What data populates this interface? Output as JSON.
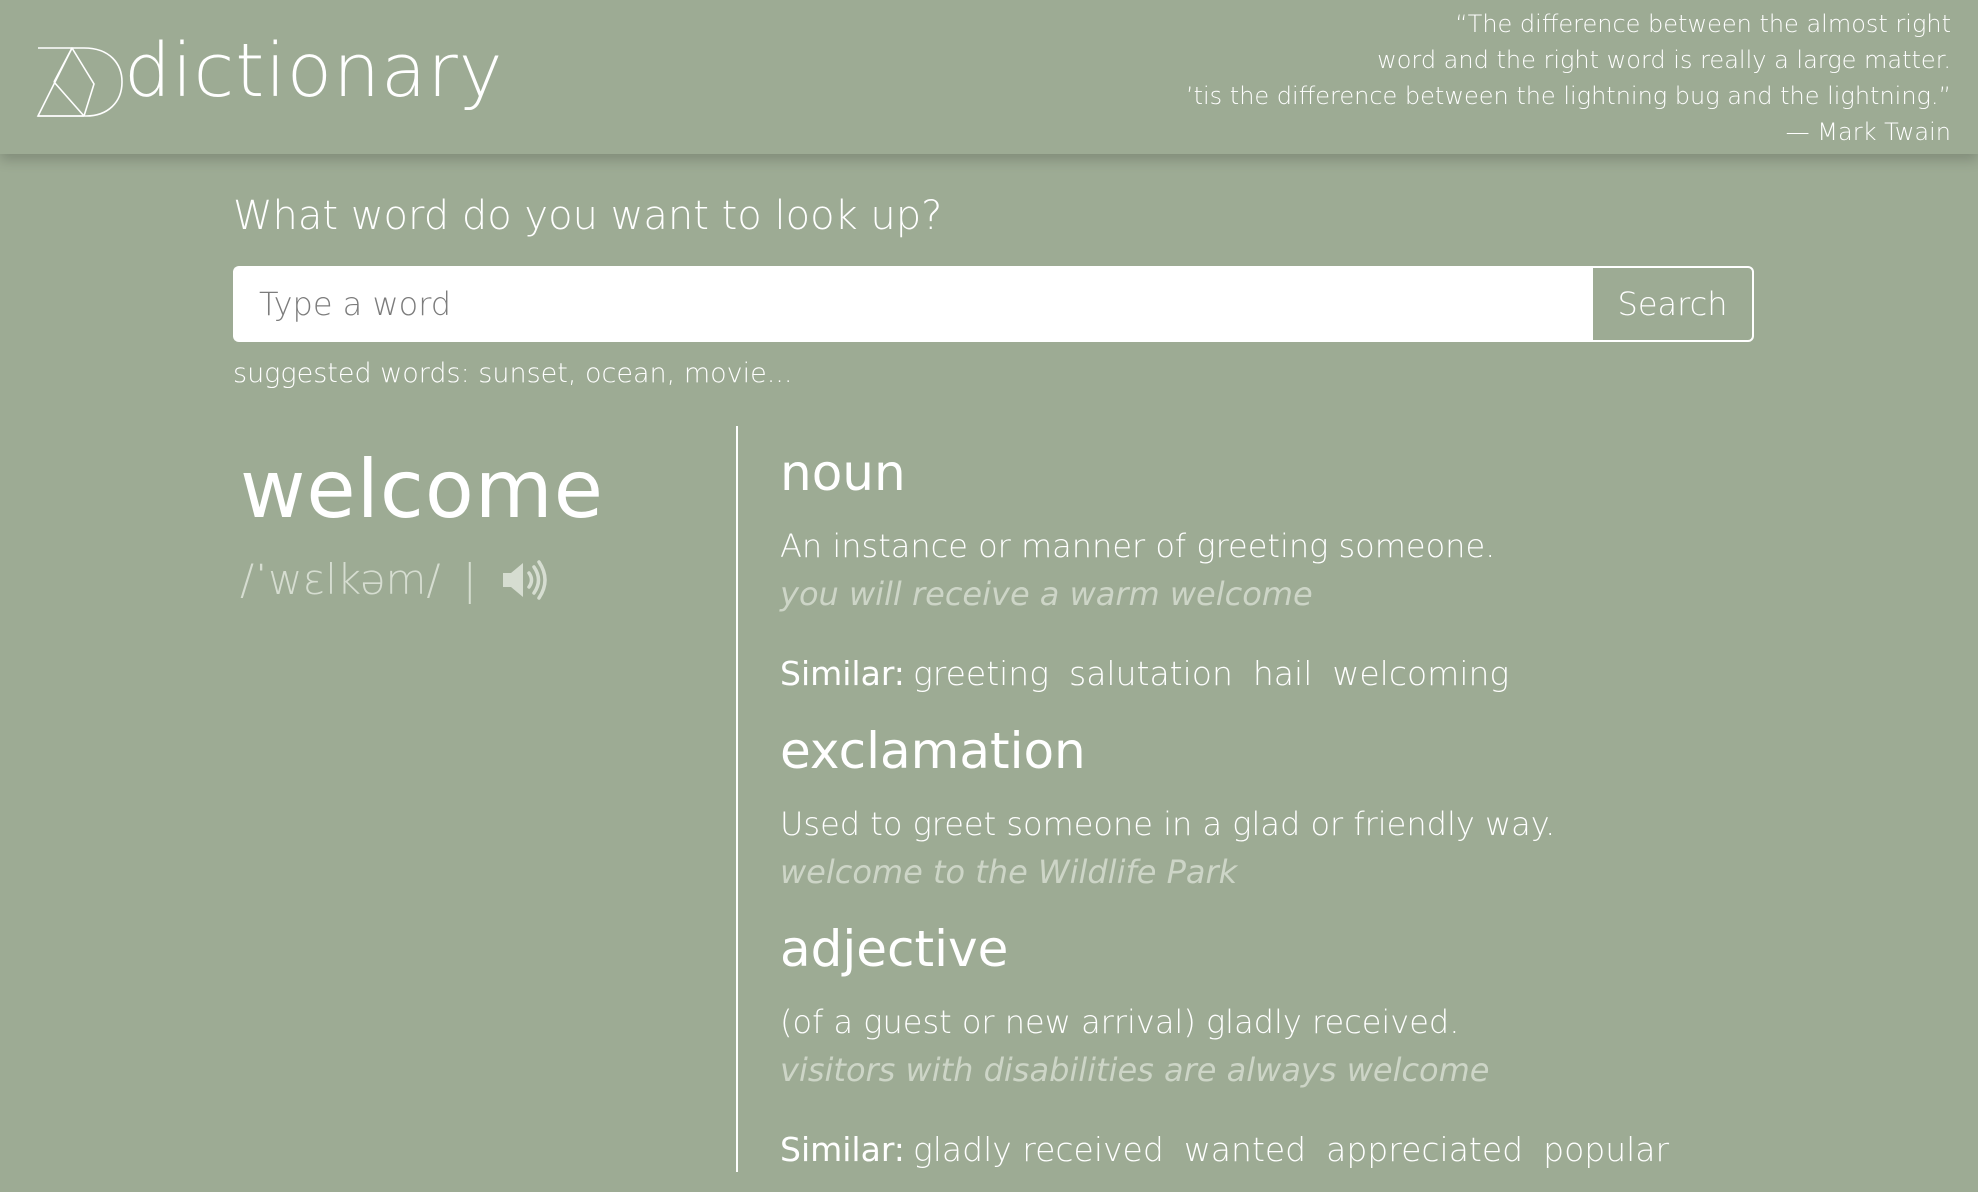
{
  "header": {
    "logo_text": "dictionary",
    "quote_lines": [
      "“The difference between the almost right",
      "word and the right word is really a large matter.",
      "’tis the difference between the lightning bug and the lightning.”",
      "— Mark Twain"
    ]
  },
  "search": {
    "question": "What word do you want to look up?",
    "placeholder": "Type a word",
    "value": "",
    "button_label": "Search",
    "suggested": "suggested words: sunset, ocean, movie..."
  },
  "word": {
    "title": "welcome",
    "phonetic": "/ˈwɛlkəm/",
    "separator": "|",
    "audio_icon": "speaker-icon"
  },
  "meanings": [
    {
      "part_of_speech": "noun",
      "definition": "An instance or manner of greeting someone.",
      "example": "you will receive a warm welcome",
      "similar_label": "Similar:",
      "similar": [
        "greeting",
        "salutation",
        "hail",
        "welcoming"
      ]
    },
    {
      "part_of_speech": "exclamation",
      "definition": "Used to greet someone in a glad or friendly way.",
      "example": "welcome to the Wildlife Park"
    },
    {
      "part_of_speech": "adjective",
      "definition": "(of a guest or new arrival) gladly received.",
      "example": "visitors with disabilities are always welcome",
      "similar_label": "Similar:",
      "similar": [
        "gladly received",
        "wanted",
        "appreciated",
        "popular"
      ]
    }
  ],
  "colors": {
    "background": "#9dab94",
    "text": "#ffffff",
    "muted": "#cdd5c7"
  }
}
